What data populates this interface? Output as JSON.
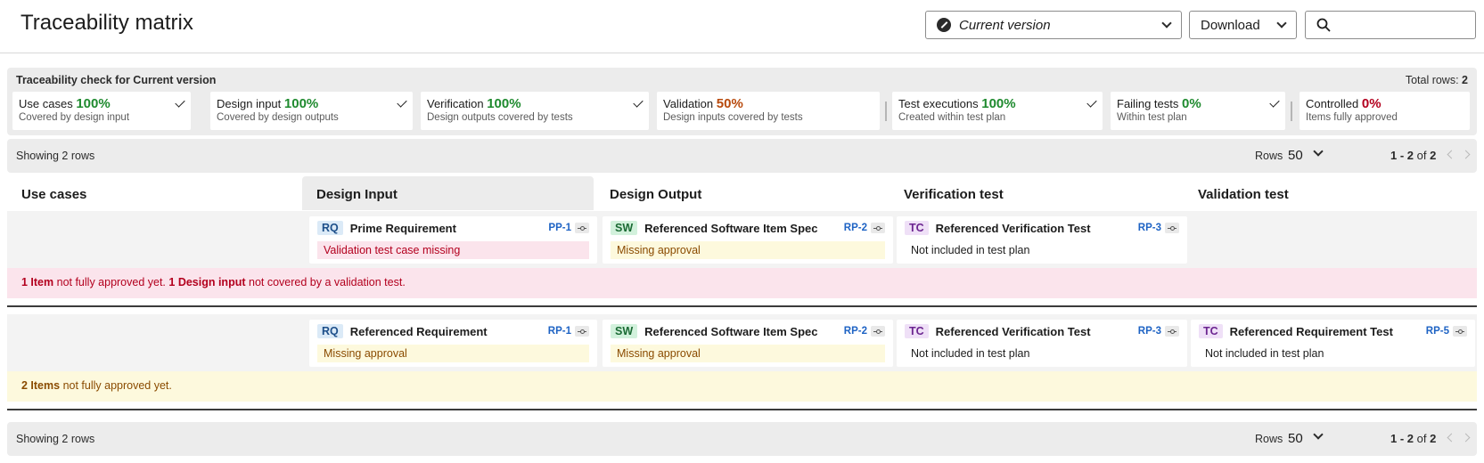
{
  "header": {
    "title": "Traceability matrix",
    "version_select": "Current version",
    "download_label": "Download",
    "search_placeholder": ""
  },
  "check": {
    "title": "Traceability check for Current version",
    "total_rows_label": "Total rows:",
    "total_rows_value": "2",
    "cards": [
      {
        "name": "Use cases",
        "pct": "100%",
        "sub": "Covered by design input",
        "status": "green",
        "checked": true
      },
      {
        "name": "Design input",
        "pct": "100%",
        "sub": "Covered by design outputs",
        "status": "green",
        "checked": true
      },
      {
        "name": "Verification",
        "pct": "100%",
        "sub": "Design outputs covered by tests",
        "status": "green",
        "checked": true
      },
      {
        "name": "Validation",
        "pct": "50%",
        "sub": "Design inputs covered by tests",
        "status": "orange",
        "checked": false
      },
      {
        "name": "Test executions",
        "pct": "100%",
        "sub": "Created within test plan",
        "status": "green",
        "checked": true
      },
      {
        "name": "Failing tests",
        "pct": "0%",
        "sub": "Within test plan",
        "status": "green",
        "checked": true
      },
      {
        "name": "Controlled",
        "pct": "0%",
        "sub": "Items fully approved",
        "status": "red",
        "checked": false
      }
    ]
  },
  "pager": {
    "showing": "Showing 2 rows",
    "rows_label": "Rows",
    "rows_value": "50",
    "range": "1 - 2",
    "of": "of",
    "total": "2"
  },
  "columns": [
    "Use cases",
    "Design Input",
    "Design Output",
    "Verification test",
    "Validation test"
  ],
  "rows": [
    {
      "cells": [
        {
          "kind": "RQ",
          "title": "Prime Requirement",
          "id": "PP-1",
          "status": "Validation test case missing",
          "tone": "red"
        },
        {
          "kind": "SW",
          "title": "Referenced Software Item Spec",
          "id": "RP-2",
          "status": "Missing approval",
          "tone": "amber"
        },
        {
          "kind": "TC",
          "title": "Referenced Verification Test",
          "id": "RP-3",
          "status": "Not included in test plan",
          "tone": "plain"
        }
      ],
      "summary": {
        "count1": "1 Item",
        "text1": " not fully approved yet. ",
        "count2": "1 Design input",
        "text2": " not covered by a validation test."
      }
    },
    {
      "cells": [
        {
          "kind": "RQ",
          "title": "Referenced Requirement",
          "id": "RP-1",
          "status": "Missing approval",
          "tone": "amber"
        },
        {
          "kind": "SW",
          "title": "Referenced Software Item Spec",
          "id": "RP-2",
          "status": "Missing approval",
          "tone": "amber"
        },
        {
          "kind": "TC",
          "title": "Referenced Verification Test",
          "id": "RP-3",
          "status": "Not included in test plan",
          "tone": "plain"
        },
        {
          "kind": "TC",
          "title": "Referenced Requirement Test",
          "id": "RP-5",
          "status": "Not included in test plan",
          "tone": "plain"
        }
      ],
      "summary": {
        "count1": "2 Items",
        "text1": " not fully approved yet."
      }
    }
  ]
}
